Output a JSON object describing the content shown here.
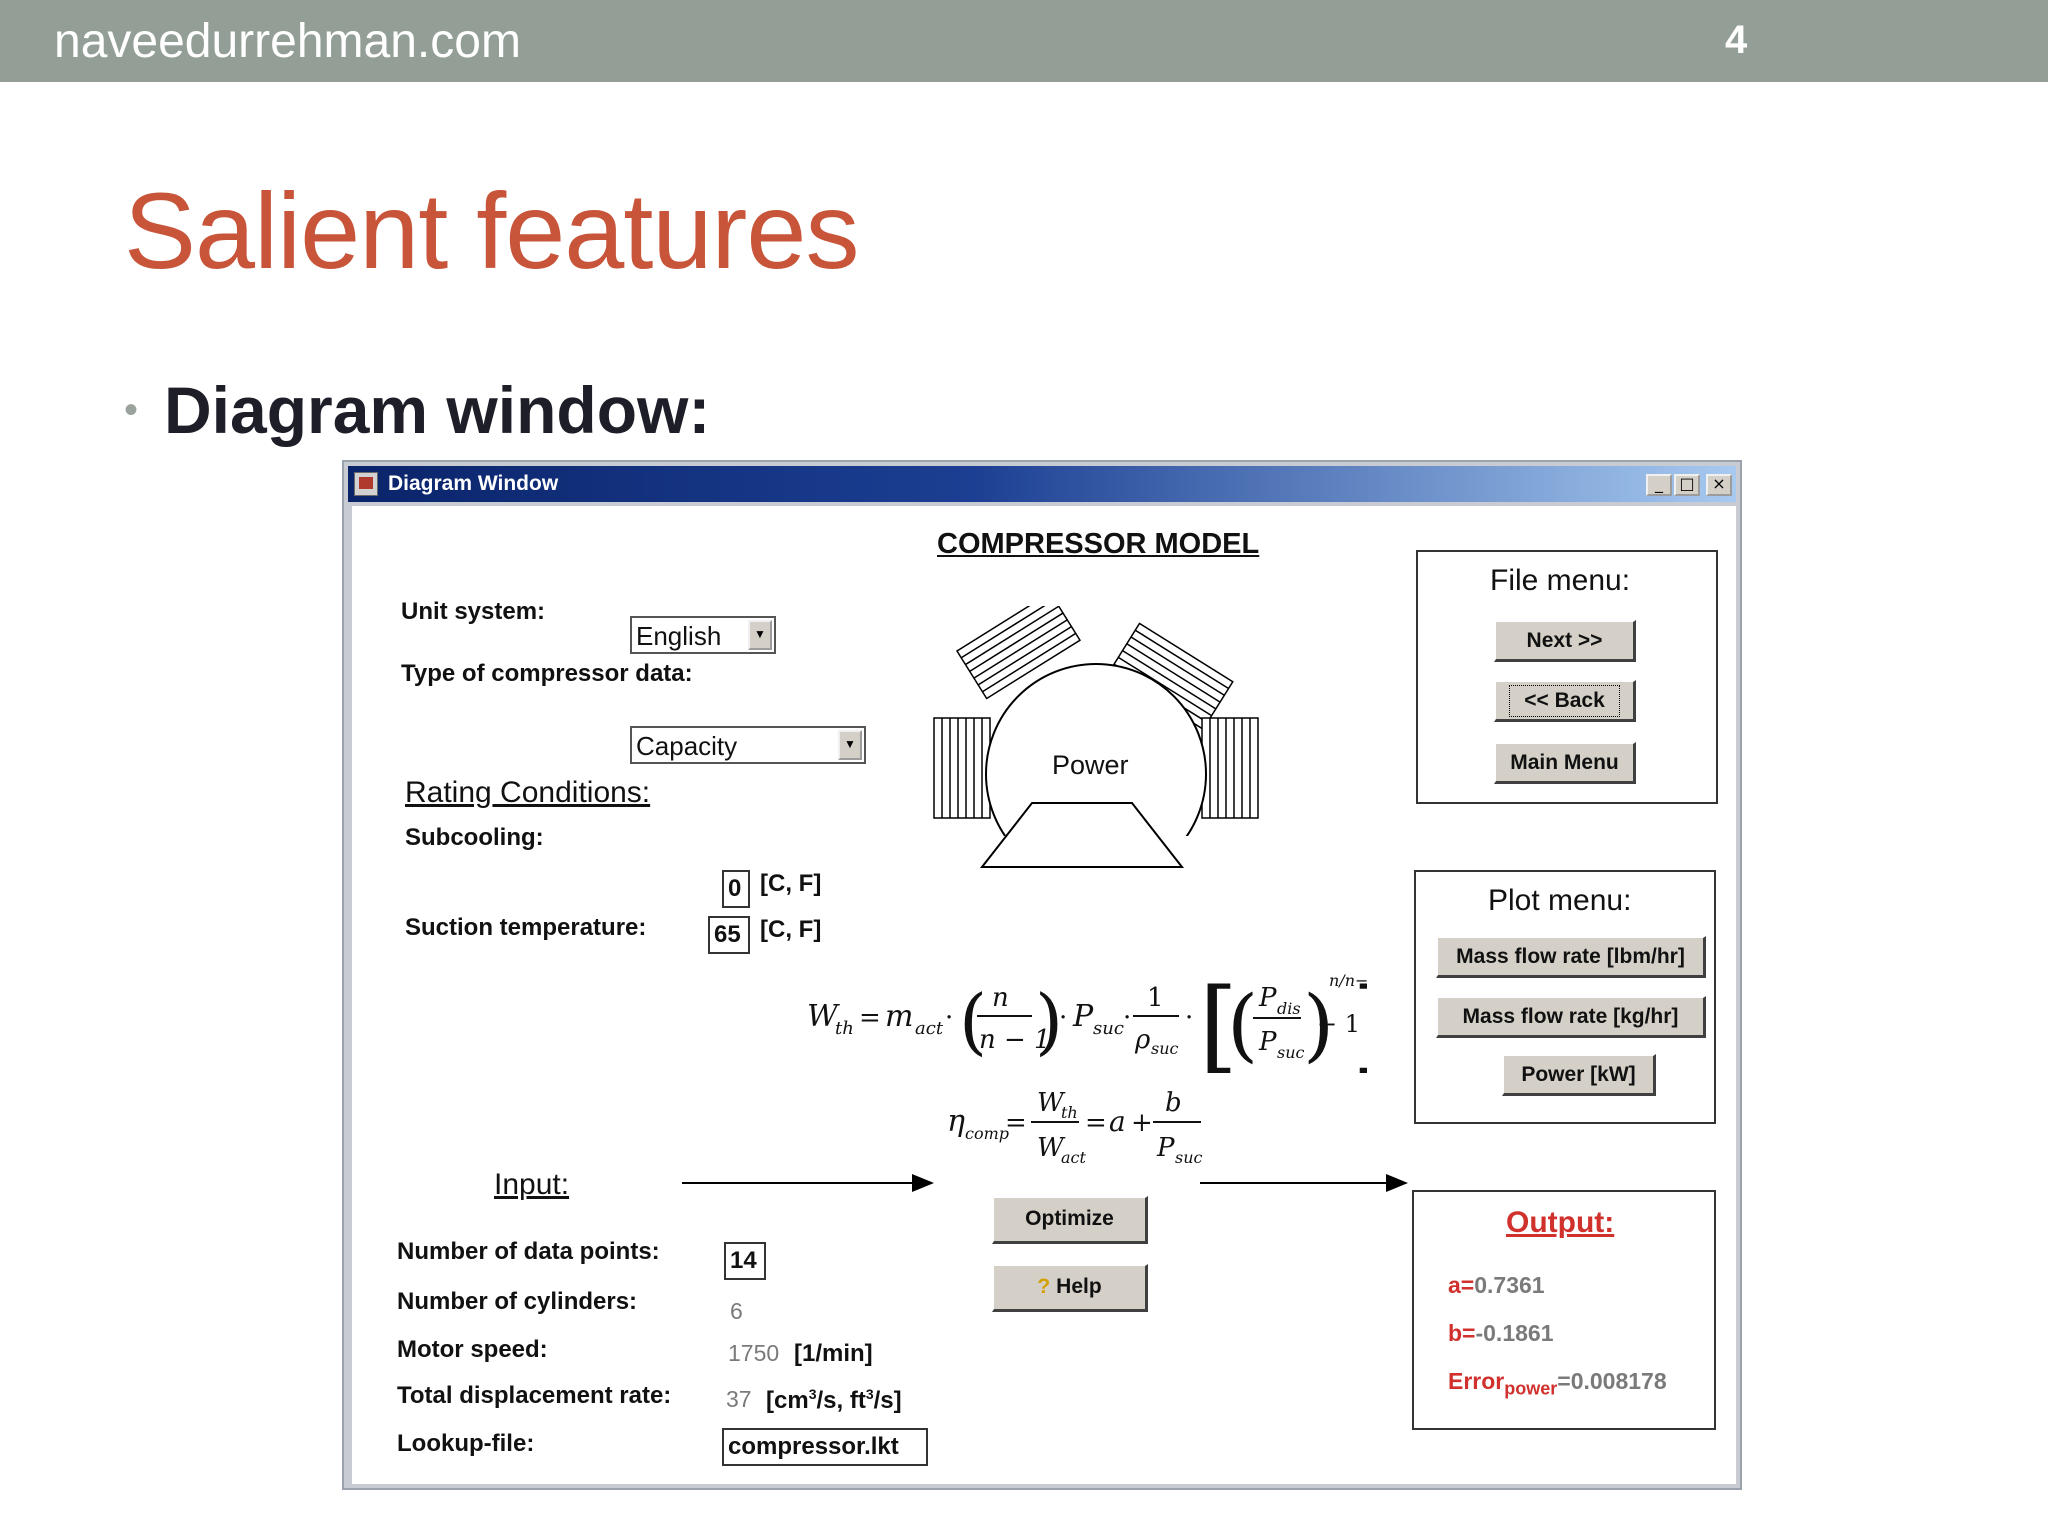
{
  "slide": {
    "site": "naveedurrehman.com",
    "page_number": "4",
    "title": "Salient features",
    "bullet": "Diagram window:"
  },
  "window": {
    "title": "Diagram Window",
    "heading": "COMPRESSOR MODEL",
    "diagram_label": "Power"
  },
  "settings": {
    "unit_system_label": "Unit system:",
    "unit_system_value": "English",
    "compressor_data_label": "Type of compressor data:",
    "compressor_data_value": "Capacity"
  },
  "rating": {
    "heading": "Rating Conditions:",
    "subcooling_label": "Subcooling:",
    "subcooling_value": "0",
    "subcooling_unit": "[C, F]",
    "suction_label": "Suction temperature:",
    "suction_value": "65",
    "suction_unit": "[C, F]"
  },
  "input": {
    "heading": "Input:",
    "data_points_label": "Number of data points:",
    "data_points_value": "14",
    "cylinders_label": "Number of cylinders:",
    "cylinders_value": "6",
    "motor_speed_label": "Motor speed:",
    "motor_speed_value": "1750",
    "motor_speed_unit": "[1/min]",
    "displacement_label": "Total displacement rate:",
    "displacement_value": "37",
    "lookup_label": "Lookup-file:",
    "lookup_value": "compressor.lkt"
  },
  "file_menu": {
    "heading": "File menu:",
    "next": "Next >>",
    "back": "<< Back",
    "main_menu": "Main Menu"
  },
  "plot_menu": {
    "heading": "Plot menu:",
    "mass_lbm": "Mass flow rate [lbm/hr]",
    "mass_kg": "Mass flow rate [kg/hr]",
    "power": "Power [kW]"
  },
  "actions": {
    "optimize": "Optimize",
    "help": "Help"
  },
  "output": {
    "heading": "Output:",
    "a_label": "a=",
    "a_value": "0.7361",
    "b_label": "b=",
    "b_value": "-0.1861",
    "error_label": "Error",
    "error_sub": "power",
    "error_value": "=0.008178"
  },
  "colors": {
    "title": "#c8553a",
    "topbar": "#939f96",
    "output_red": "#d0312d",
    "titlebar": "#0a246a"
  }
}
